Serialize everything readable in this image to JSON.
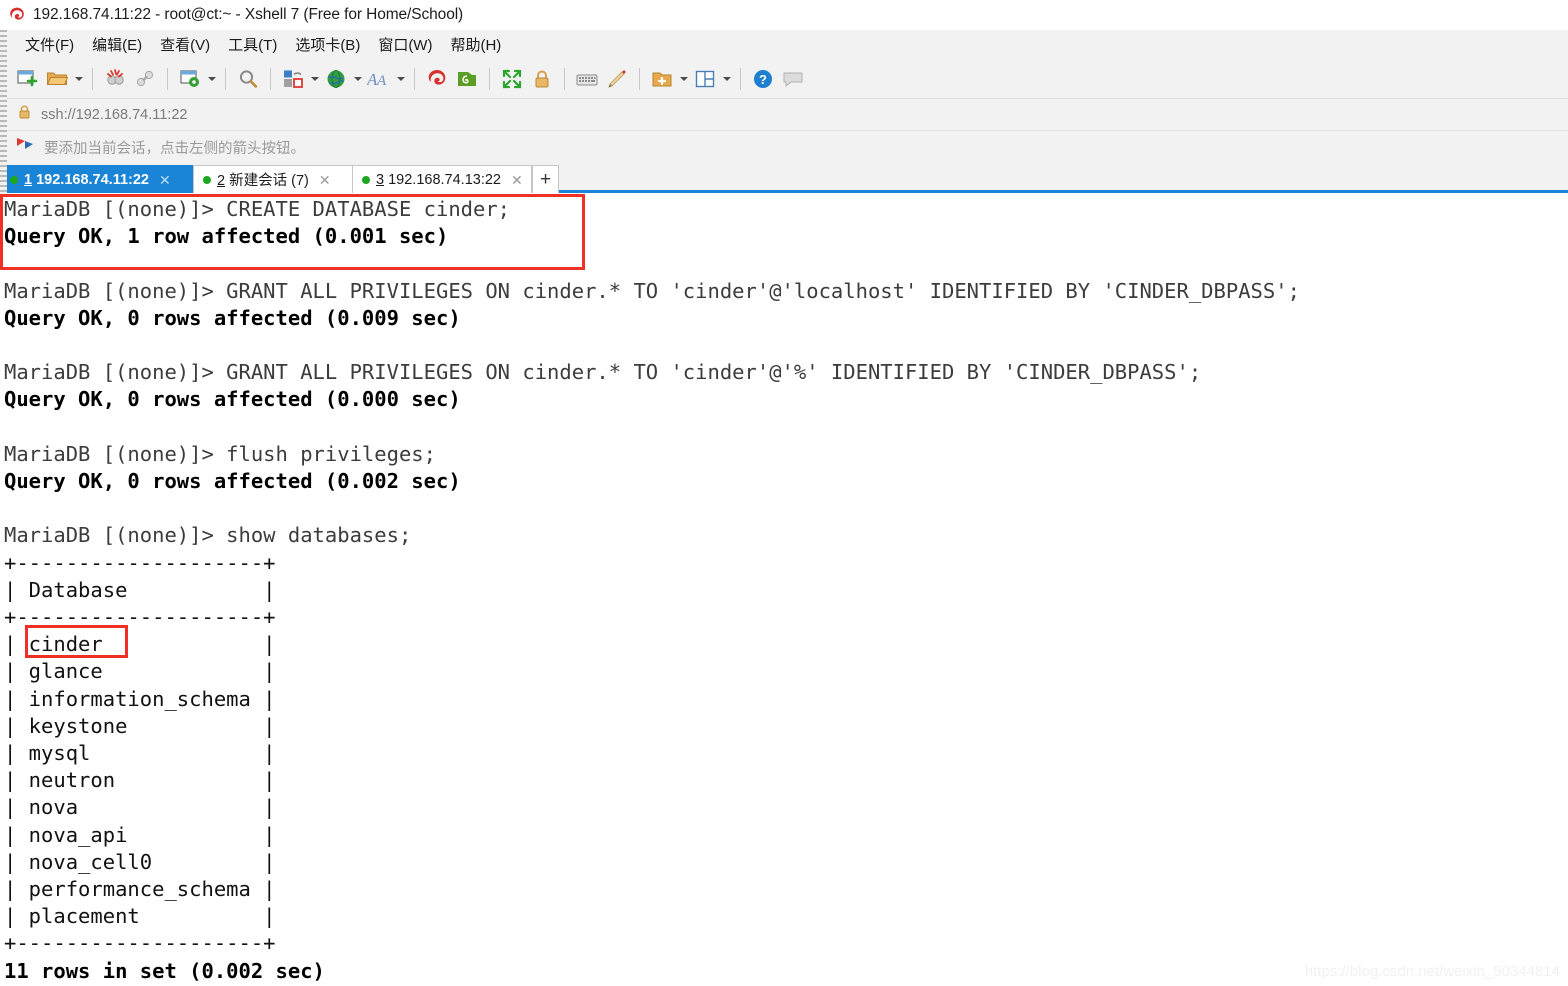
{
  "window": {
    "title": "192.168.74.11:22 - root@ct:~ - Xshell 7 (Free for Home/School)",
    "app_icon": "xshell-logo-icon"
  },
  "menubar": {
    "items": [
      {
        "label": "文件(F)",
        "name": "menu-file"
      },
      {
        "label": "编辑(E)",
        "name": "menu-edit"
      },
      {
        "label": "查看(V)",
        "name": "menu-view"
      },
      {
        "label": "工具(T)",
        "name": "menu-tools"
      },
      {
        "label": "选项卡(B)",
        "name": "menu-tabs"
      },
      {
        "label": "窗口(W)",
        "name": "menu-window"
      },
      {
        "label": "帮助(H)",
        "name": "menu-help"
      }
    ]
  },
  "toolbar": {
    "icons": [
      "new-session-icon",
      "open-folder-icon",
      "disconnect-icon",
      "reconnect-icon",
      "session-properties-icon",
      "find-icon",
      "transfer-file-icon",
      "globe-icon",
      "font-size-icon",
      "xshell-icon",
      "xftp-icon",
      "fullscreen-icon",
      "lock-icon",
      "keyboard-icon",
      "compose-icon",
      "add-folder-icon",
      "layout-icon",
      "help-icon",
      "chat-icon"
    ]
  },
  "address_bar": {
    "lock_icon": "lock-icon",
    "value": "ssh://192.168.74.11:22"
  },
  "hint_bar": {
    "icon": "bookmark-flag-icon",
    "text": "要添加当前会话，点击左侧的箭头按钮。"
  },
  "tabs": {
    "items": [
      {
        "num": "1",
        "label": " 192.168.74.11:22",
        "active": true,
        "status": "connected"
      },
      {
        "num": "2",
        "label": " 新建会话 (7)",
        "active": false,
        "status": "connected"
      },
      {
        "num": "3",
        "label": " 192.168.74.13:22",
        "active": false,
        "status": "connected"
      }
    ],
    "add_label": "+",
    "close_glyph": "✕"
  },
  "terminal": {
    "lines": [
      {
        "type": "prompt",
        "text": "MariaDB [(none)]> CREATE DATABASE cinder;"
      },
      {
        "type": "out",
        "text": "Query OK, 1 row affected (0.001 sec)"
      },
      {
        "type": "blank",
        "text": ""
      },
      {
        "type": "prompt",
        "text": "MariaDB [(none)]> GRANT ALL PRIVILEGES ON cinder.* TO 'cinder'@'localhost' IDENTIFIED BY 'CINDER_DBPASS';"
      },
      {
        "type": "out",
        "text": "Query OK, 0 rows affected (0.009 sec)"
      },
      {
        "type": "blank",
        "text": ""
      },
      {
        "type": "prompt",
        "text": "MariaDB [(none)]> GRANT ALL PRIVILEGES ON cinder.* TO 'cinder'@'%' IDENTIFIED BY 'CINDER_DBPASS';"
      },
      {
        "type": "out",
        "text": "Query OK, 0 rows affected (0.000 sec)"
      },
      {
        "type": "blank",
        "text": ""
      },
      {
        "type": "prompt",
        "text": "MariaDB [(none)]> flush privileges;"
      },
      {
        "type": "out",
        "text": "Query OK, 0 rows affected (0.002 sec)"
      },
      {
        "type": "blank",
        "text": ""
      },
      {
        "type": "prompt",
        "text": "MariaDB [(none)]> show databases;"
      },
      {
        "type": "tbl",
        "text": "+--------------------+"
      },
      {
        "type": "tbl",
        "text": "| Database           |"
      },
      {
        "type": "tbl",
        "text": "+--------------------+"
      },
      {
        "type": "tbl",
        "text": "| cinder             |"
      },
      {
        "type": "tbl",
        "text": "| glance             |"
      },
      {
        "type": "tbl",
        "text": "| information_schema |"
      },
      {
        "type": "tbl",
        "text": "| keystone           |"
      },
      {
        "type": "tbl",
        "text": "| mysql              |"
      },
      {
        "type": "tbl",
        "text": "| neutron            |"
      },
      {
        "type": "tbl",
        "text": "| nova               |"
      },
      {
        "type": "tbl",
        "text": "| nova_api           |"
      },
      {
        "type": "tbl",
        "text": "| nova_cell0         |"
      },
      {
        "type": "tbl",
        "text": "| performance_schema |"
      },
      {
        "type": "tbl",
        "text": "| placement          |"
      },
      {
        "type": "tbl",
        "text": "+--------------------+"
      },
      {
        "type": "out",
        "text": "11 rows in set (0.002 sec)"
      }
    ]
  },
  "annotations": {
    "highlight_color": "#ee3124",
    "boxes": [
      {
        "name": "create-database-highlight"
      },
      {
        "name": "cinder-row-highlight"
      }
    ]
  },
  "watermark": {
    "text": "https://blog.csdn.net/weixin_50344814"
  }
}
